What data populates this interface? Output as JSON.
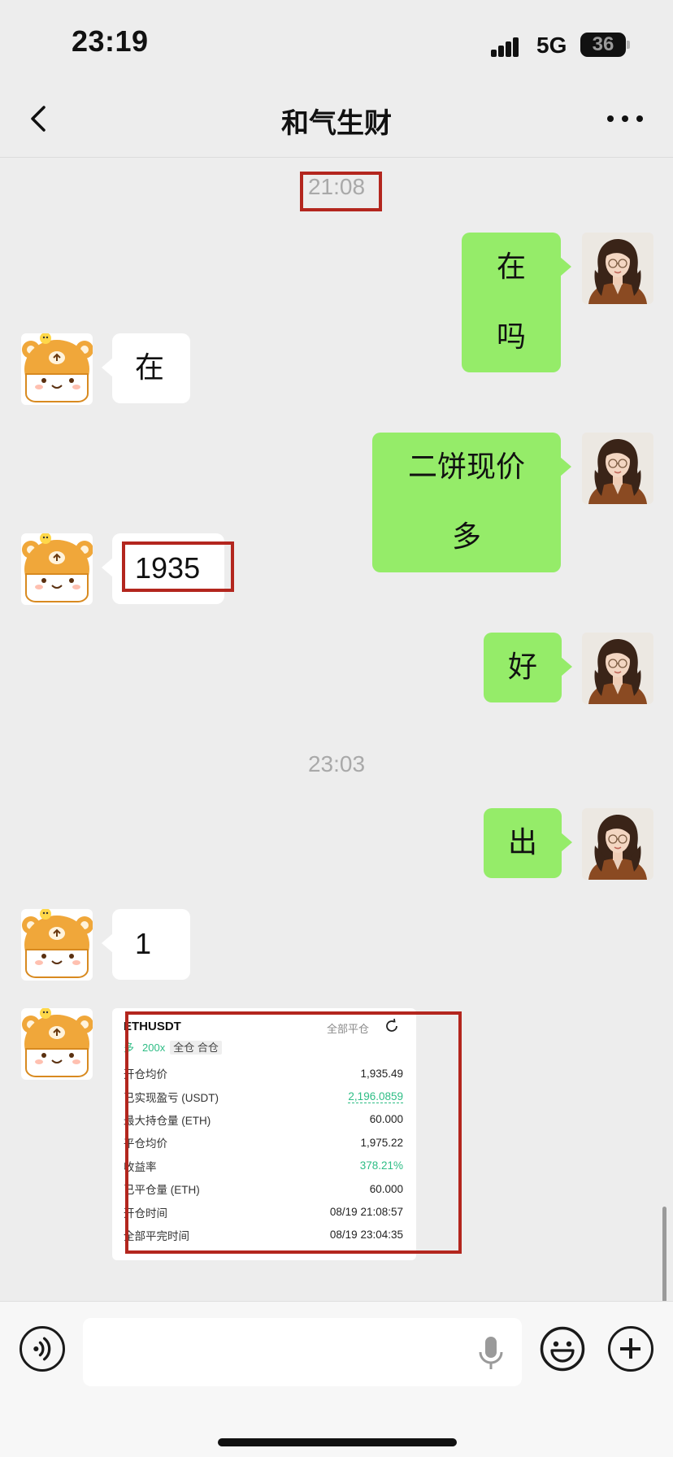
{
  "status_bar": {
    "time": "23:19",
    "network": "5G",
    "battery": "36"
  },
  "nav": {
    "title": "和气生财",
    "back_icon": "chevron-left-icon",
    "more_icon": "more-dots-icon"
  },
  "timestamps": [
    "21:08",
    "23:03"
  ],
  "messages": [
    {
      "side": "out",
      "text": "在吗"
    },
    {
      "side": "in",
      "text": "在"
    },
    {
      "side": "out",
      "text": "二饼现价多"
    },
    {
      "side": "in",
      "text": "1935"
    },
    {
      "side": "out",
      "text": "好"
    },
    {
      "side": "out",
      "text": "出"
    },
    {
      "side": "in",
      "text": "1"
    }
  ],
  "trade_card": {
    "symbol": "ETHUSDT",
    "close_all": "全部平仓",
    "direction": "多",
    "leverage": "200x",
    "margin_mode": "全仓 合仓",
    "rows": [
      {
        "label": "开仓均价",
        "value": "1,935.49"
      },
      {
        "label": "已实现盈亏 (USDT)",
        "value": "2,196.0859"
      },
      {
        "label": "最大持仓量 (ETH)",
        "value": "60.000"
      },
      {
        "label": "平仓均价",
        "value": "1,975.22"
      },
      {
        "label": "收益率",
        "value": "378.21%"
      },
      {
        "label": "已平仓量 (ETH)",
        "value": "60.000"
      },
      {
        "label": "开仓时间",
        "value": "08/19 21:08:57"
      },
      {
        "label": "全部平完时间",
        "value": "08/19 23:04:35"
      }
    ]
  },
  "colors": {
    "outgoing_bubble": "#95ec69",
    "incoming_bubble": "#ffffff",
    "background": "#ededed",
    "highlight_box": "#b3261e",
    "profit_green": "#2ebd85"
  },
  "avatars": {
    "self": "woman-avatar",
    "contact": "bear-cartoon-avatar"
  },
  "input_bar": {
    "voice_icon": "voice-icon",
    "mic_icon": "microphone-icon",
    "emoji_icon": "emoji-icon",
    "plus_icon": "plus-icon"
  }
}
